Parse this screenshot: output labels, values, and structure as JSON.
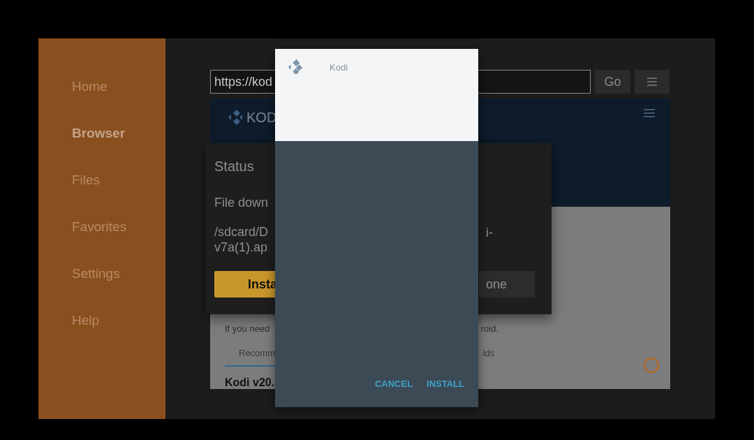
{
  "sidebar": {
    "items": [
      {
        "label": "Home",
        "selected": false
      },
      {
        "label": "Browser",
        "selected": true
      },
      {
        "label": "Files",
        "selected": false
      },
      {
        "label": "Favorites",
        "selected": false
      },
      {
        "label": "Settings",
        "selected": false
      },
      {
        "label": "Help",
        "selected": false
      }
    ]
  },
  "url_bar": {
    "value": "https://kod",
    "go": "Go"
  },
  "web_page": {
    "brand": "KOD",
    "notice_left": "If you need",
    "notice_right": "roid.",
    "tabs": [
      {
        "label": "Recomm",
        "selected": true
      },
      {
        "label": "lds",
        "selected": false
      }
    ],
    "heading": "Kodi v20."
  },
  "status_dialog": {
    "title": "Status",
    "message": "File down",
    "path_left": [
      "/sdcard/D",
      "v7a(1).ap"
    ],
    "path_right": "i-",
    "install": "Insta",
    "done": "one"
  },
  "install_dialog": {
    "title": "Kodi",
    "buttons": [
      {
        "label": "CANCEL"
      },
      {
        "label": "INSTALL"
      }
    ]
  }
}
